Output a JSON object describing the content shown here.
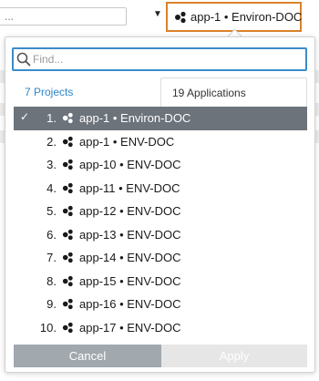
{
  "background": {
    "input_text": "...",
    "caret": "▼"
  },
  "selector": {
    "label": "app-1 • Environ-DOC",
    "icon": "app-cluster-icon",
    "outline_color": "#d9822b"
  },
  "popup": {
    "search": {
      "placeholder": "Find...",
      "value": ""
    },
    "tabs": [
      {
        "label": "7 Projects",
        "active": true
      },
      {
        "label": "19 Applications",
        "active": false
      }
    ],
    "items": [
      {
        "num": "1.",
        "label": "app-1 • Environ-DOC",
        "selected": true
      },
      {
        "num": "2.",
        "label": "app-1 • ENV-DOC",
        "selected": false
      },
      {
        "num": "3.",
        "label": "app-10 • ENV-DOC",
        "selected": false
      },
      {
        "num": "4.",
        "label": "app-11 • ENV-DOC",
        "selected": false
      },
      {
        "num": "5.",
        "label": "app-12 • ENV-DOC",
        "selected": false
      },
      {
        "num": "6.",
        "label": "app-13 • ENV-DOC",
        "selected": false
      },
      {
        "num": "7.",
        "label": "app-14 • ENV-DOC",
        "selected": false
      },
      {
        "num": "8.",
        "label": "app-15 • ENV-DOC",
        "selected": false
      },
      {
        "num": "9.",
        "label": "app-16 • ENV-DOC",
        "selected": false
      },
      {
        "num": "10.",
        "label": "app-17 • ENV-DOC",
        "selected": false
      }
    ],
    "check_glyph": "✓",
    "buttons": {
      "cancel": "Cancel",
      "apply": "Apply"
    }
  },
  "colors": {
    "accent_blue": "#2f86c8",
    "selected_row": "#6c737b",
    "cancel_button": "#a1a8ae",
    "apply_button_disabled": "#e6e6e6"
  }
}
